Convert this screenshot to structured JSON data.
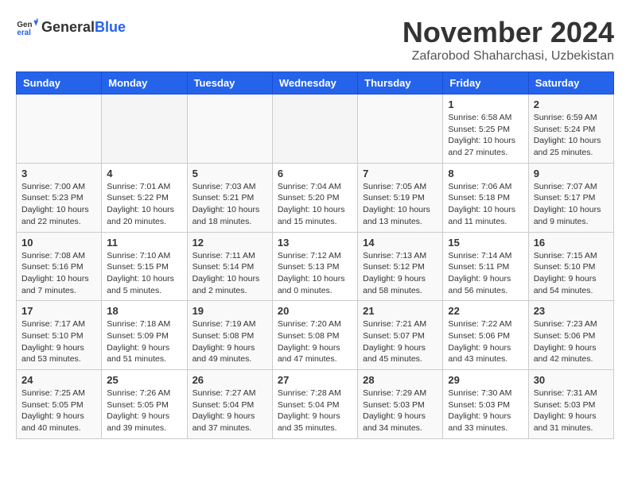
{
  "header": {
    "logo_general": "General",
    "logo_blue": "Blue",
    "month": "November 2024",
    "location": "Zafarobod Shaharchasi, Uzbekistan"
  },
  "weekdays": [
    "Sunday",
    "Monday",
    "Tuesday",
    "Wednesday",
    "Thursday",
    "Friday",
    "Saturday"
  ],
  "weeks": [
    [
      {
        "day": "",
        "info": ""
      },
      {
        "day": "",
        "info": ""
      },
      {
        "day": "",
        "info": ""
      },
      {
        "day": "",
        "info": ""
      },
      {
        "day": "",
        "info": ""
      },
      {
        "day": "1",
        "info": "Sunrise: 6:58 AM\nSunset: 5:25 PM\nDaylight: 10 hours and 27 minutes."
      },
      {
        "day": "2",
        "info": "Sunrise: 6:59 AM\nSunset: 5:24 PM\nDaylight: 10 hours and 25 minutes."
      }
    ],
    [
      {
        "day": "3",
        "info": "Sunrise: 7:00 AM\nSunset: 5:23 PM\nDaylight: 10 hours and 22 minutes."
      },
      {
        "day": "4",
        "info": "Sunrise: 7:01 AM\nSunset: 5:22 PM\nDaylight: 10 hours and 20 minutes."
      },
      {
        "day": "5",
        "info": "Sunrise: 7:03 AM\nSunset: 5:21 PM\nDaylight: 10 hours and 18 minutes."
      },
      {
        "day": "6",
        "info": "Sunrise: 7:04 AM\nSunset: 5:20 PM\nDaylight: 10 hours and 15 minutes."
      },
      {
        "day": "7",
        "info": "Sunrise: 7:05 AM\nSunset: 5:19 PM\nDaylight: 10 hours and 13 minutes."
      },
      {
        "day": "8",
        "info": "Sunrise: 7:06 AM\nSunset: 5:18 PM\nDaylight: 10 hours and 11 minutes."
      },
      {
        "day": "9",
        "info": "Sunrise: 7:07 AM\nSunset: 5:17 PM\nDaylight: 10 hours and 9 minutes."
      }
    ],
    [
      {
        "day": "10",
        "info": "Sunrise: 7:08 AM\nSunset: 5:16 PM\nDaylight: 10 hours and 7 minutes."
      },
      {
        "day": "11",
        "info": "Sunrise: 7:10 AM\nSunset: 5:15 PM\nDaylight: 10 hours and 5 minutes."
      },
      {
        "day": "12",
        "info": "Sunrise: 7:11 AM\nSunset: 5:14 PM\nDaylight: 10 hours and 2 minutes."
      },
      {
        "day": "13",
        "info": "Sunrise: 7:12 AM\nSunset: 5:13 PM\nDaylight: 10 hours and 0 minutes."
      },
      {
        "day": "14",
        "info": "Sunrise: 7:13 AM\nSunset: 5:12 PM\nDaylight: 9 hours and 58 minutes."
      },
      {
        "day": "15",
        "info": "Sunrise: 7:14 AM\nSunset: 5:11 PM\nDaylight: 9 hours and 56 minutes."
      },
      {
        "day": "16",
        "info": "Sunrise: 7:15 AM\nSunset: 5:10 PM\nDaylight: 9 hours and 54 minutes."
      }
    ],
    [
      {
        "day": "17",
        "info": "Sunrise: 7:17 AM\nSunset: 5:10 PM\nDaylight: 9 hours and 53 minutes."
      },
      {
        "day": "18",
        "info": "Sunrise: 7:18 AM\nSunset: 5:09 PM\nDaylight: 9 hours and 51 minutes."
      },
      {
        "day": "19",
        "info": "Sunrise: 7:19 AM\nSunset: 5:08 PM\nDaylight: 9 hours and 49 minutes."
      },
      {
        "day": "20",
        "info": "Sunrise: 7:20 AM\nSunset: 5:08 PM\nDaylight: 9 hours and 47 minutes."
      },
      {
        "day": "21",
        "info": "Sunrise: 7:21 AM\nSunset: 5:07 PM\nDaylight: 9 hours and 45 minutes."
      },
      {
        "day": "22",
        "info": "Sunrise: 7:22 AM\nSunset: 5:06 PM\nDaylight: 9 hours and 43 minutes."
      },
      {
        "day": "23",
        "info": "Sunrise: 7:23 AM\nSunset: 5:06 PM\nDaylight: 9 hours and 42 minutes."
      }
    ],
    [
      {
        "day": "24",
        "info": "Sunrise: 7:25 AM\nSunset: 5:05 PM\nDaylight: 9 hours and 40 minutes."
      },
      {
        "day": "25",
        "info": "Sunrise: 7:26 AM\nSunset: 5:05 PM\nDaylight: 9 hours and 39 minutes."
      },
      {
        "day": "26",
        "info": "Sunrise: 7:27 AM\nSunset: 5:04 PM\nDaylight: 9 hours and 37 minutes."
      },
      {
        "day": "27",
        "info": "Sunrise: 7:28 AM\nSunset: 5:04 PM\nDaylight: 9 hours and 35 minutes."
      },
      {
        "day": "28",
        "info": "Sunrise: 7:29 AM\nSunset: 5:03 PM\nDaylight: 9 hours and 34 minutes."
      },
      {
        "day": "29",
        "info": "Sunrise: 7:30 AM\nSunset: 5:03 PM\nDaylight: 9 hours and 33 minutes."
      },
      {
        "day": "30",
        "info": "Sunrise: 7:31 AM\nSunset: 5:03 PM\nDaylight: 9 hours and 31 minutes."
      }
    ]
  ]
}
